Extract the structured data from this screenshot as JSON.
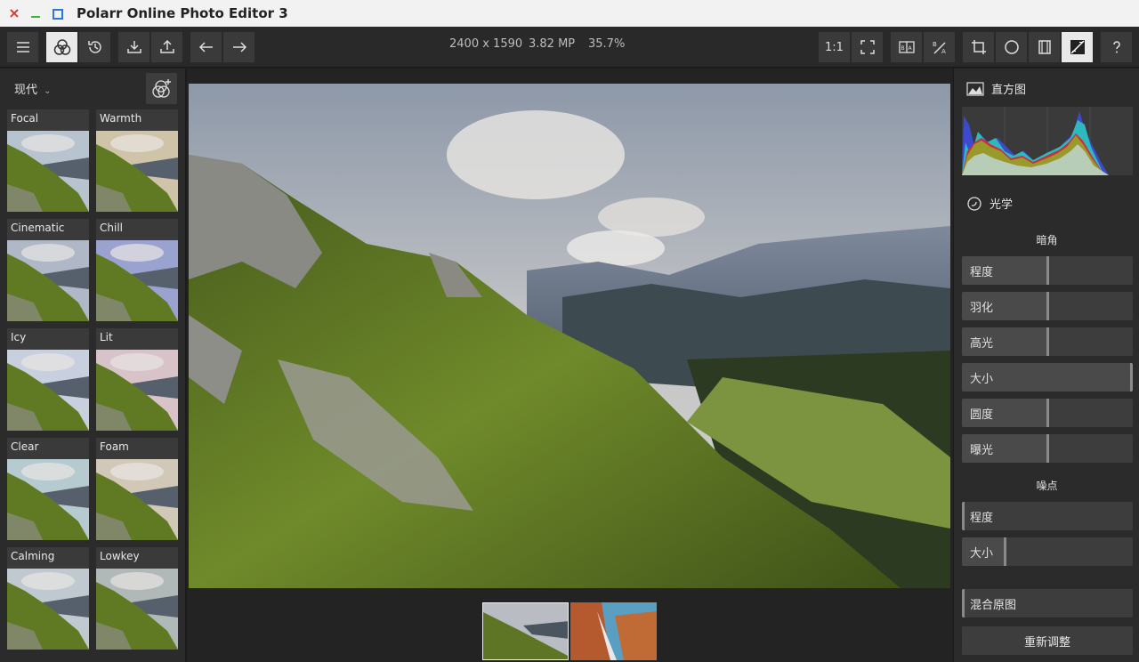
{
  "window": {
    "title": "Polarr Online Photo Editor 3"
  },
  "toolbar": {
    "dimensions": "2400 x 1590",
    "megapixels": "3.82 MP",
    "zoom": "35.7%",
    "ratio_label": "1:1",
    "compare_label": "B|A"
  },
  "left": {
    "collection": "现代",
    "presets": [
      {
        "label": "Focal"
      },
      {
        "label": "Warmth"
      },
      {
        "label": "Cinematic"
      },
      {
        "label": "Chill"
      },
      {
        "label": "Icy"
      },
      {
        "label": "Lit"
      },
      {
        "label": "Clear"
      },
      {
        "label": "Foam"
      },
      {
        "label": "Calming"
      },
      {
        "label": "Lowkey"
      }
    ]
  },
  "right": {
    "histogram_title": "直方图",
    "optics_title": "光学",
    "vignette": {
      "title": "暗角",
      "sliders": [
        {
          "label": "程度",
          "value": 0.5
        },
        {
          "label": "羽化",
          "value": 0.5
        },
        {
          "label": "高光",
          "value": 0.5
        },
        {
          "label": "大小",
          "value": 1.0
        },
        {
          "label": "圆度",
          "value": 0.5
        },
        {
          "label": "曝光",
          "value": 0.5
        }
      ]
    },
    "grain": {
      "title": "噪点",
      "sliders": [
        {
          "label": "程度",
          "value": 0.0
        },
        {
          "label": "大小",
          "value": 0.25
        }
      ]
    },
    "blend_label": "混合原图",
    "reset_label": "重新调整"
  },
  "colors": {
    "accent": "#e9e9e9",
    "panel": "#2b2b2b",
    "close": "#e0342b",
    "minimize": "#35b935",
    "maximize": "#2b78e4"
  }
}
